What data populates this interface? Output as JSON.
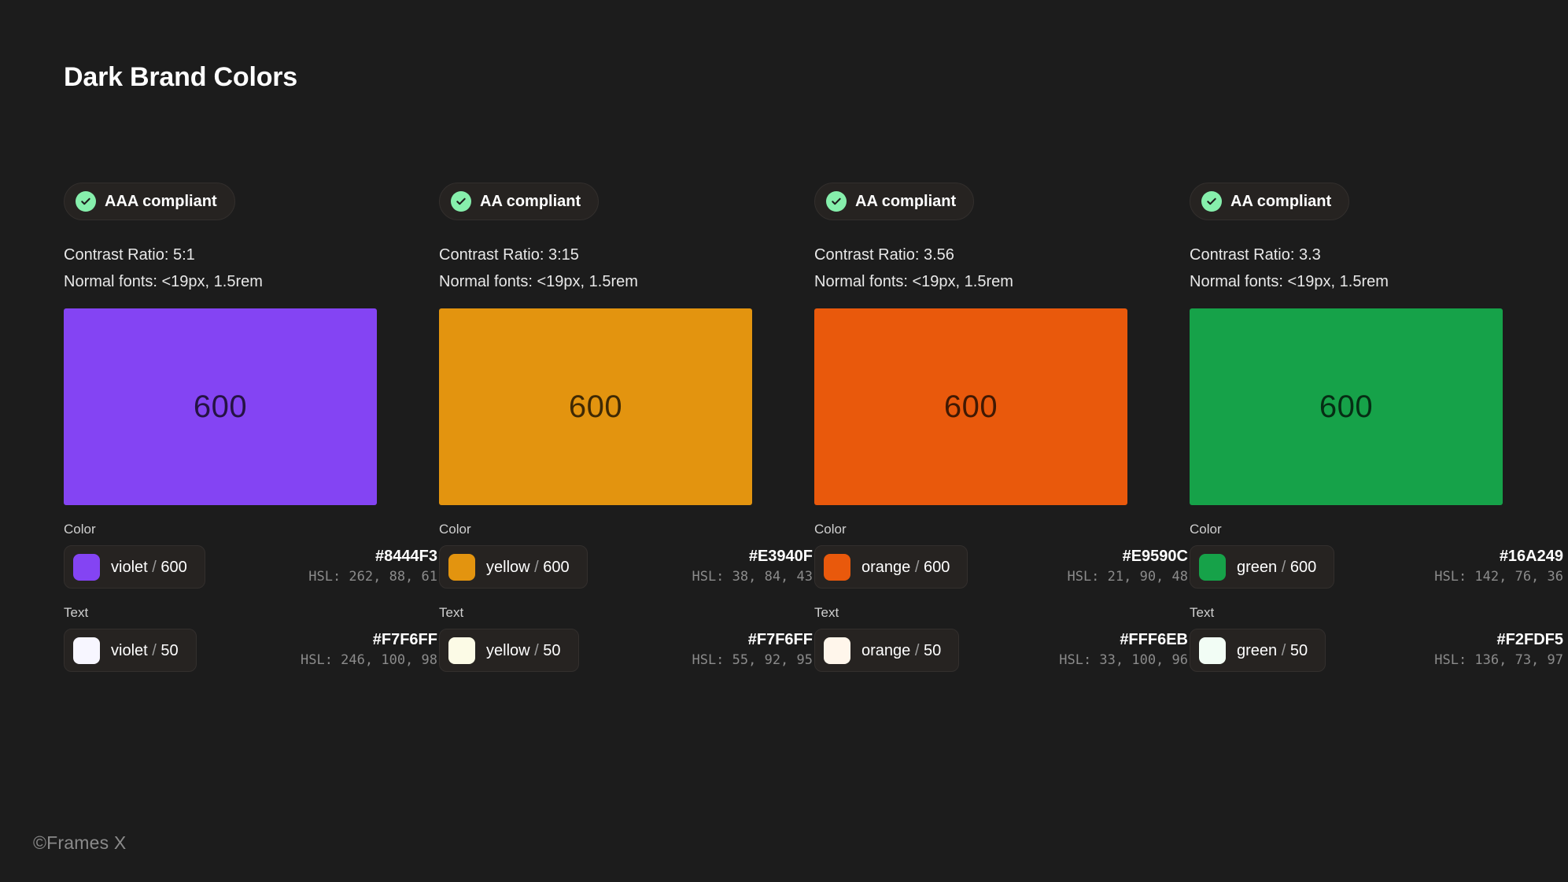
{
  "page": {
    "title": "Dark Brand Colors",
    "background": "#1C1C1C",
    "footer": "©Frames X"
  },
  "labels": {
    "color_section": "Color",
    "text_section": "Text",
    "check_icon": "check-circle-icon"
  },
  "columns": [
    {
      "id": "violet",
      "badge": "AAA compliant",
      "contrast_line": "Contrast Ratio: 5:1",
      "fonts_line": "Normal fonts: <19px, 1.5rem",
      "swatch": {
        "label": "600",
        "hex": "#8444F3"
      },
      "color": {
        "section": "Color",
        "name": "violet",
        "separator": "/",
        "step": "600",
        "hex": "#8444F3",
        "hsl": "HSL: 262, 88, 61",
        "swatch_hex": "#8444F3"
      },
      "text": {
        "section": "Text",
        "name": "violet",
        "separator": "/",
        "step": "50",
        "hex": "#F7F6FF",
        "hsl": "HSL: 246, 100, 98",
        "swatch_hex": "#F7F6FF"
      }
    },
    {
      "id": "yellow",
      "badge": "AA compliant",
      "contrast_line": "Contrast Ratio: 3:15",
      "fonts_line": "Normal fonts: <19px, 1.5rem",
      "swatch": {
        "label": "600",
        "hex": "#E3940F"
      },
      "color": {
        "section": "Color",
        "name": "yellow",
        "separator": "/",
        "step": "600",
        "hex": "#E3940F",
        "hsl": "HSL: 38, 84, 43",
        "swatch_hex": "#E3940F"
      },
      "text": {
        "section": "Text",
        "name": "yellow",
        "separator": "/",
        "step": "50",
        "hex": "#F7F6FF",
        "hsl": "HSL: 55, 92, 95",
        "swatch_hex": "#FCFBE6"
      }
    },
    {
      "id": "orange",
      "badge": "AA compliant",
      "contrast_line": "Contrast Ratio: 3.56",
      "fonts_line": "Normal fonts: <19px, 1.5rem",
      "swatch": {
        "label": "600",
        "hex": "#E9590C"
      },
      "color": {
        "section": "Color",
        "name": "orange",
        "separator": "/",
        "step": "600",
        "hex": "#E9590C",
        "hsl": "HSL: 21, 90, 48",
        "swatch_hex": "#E9590C"
      },
      "text": {
        "section": "Text",
        "name": "orange",
        "separator": "/",
        "step": "50",
        "hex": "#FFF6EB",
        "hsl": "HSL: 33, 100, 96",
        "swatch_hex": "#FFF6EB"
      }
    },
    {
      "id": "green",
      "badge": "AA compliant",
      "contrast_line": "Contrast Ratio: 3.3",
      "fonts_line": "Normal fonts: <19px, 1.5rem",
      "swatch": {
        "label": "600",
        "hex": "#16A249"
      },
      "color": {
        "section": "Color",
        "name": "green",
        "separator": "/",
        "step": "600",
        "hex": "#16A249",
        "hsl": "HSL: 142, 76, 36",
        "swatch_hex": "#16A249"
      },
      "text": {
        "section": "Text",
        "name": "green",
        "separator": "/",
        "step": "50",
        "hex": "#F2FDF5",
        "hsl": "HSL: 136, 73, 97",
        "swatch_hex": "#F2FDF5"
      }
    }
  ]
}
